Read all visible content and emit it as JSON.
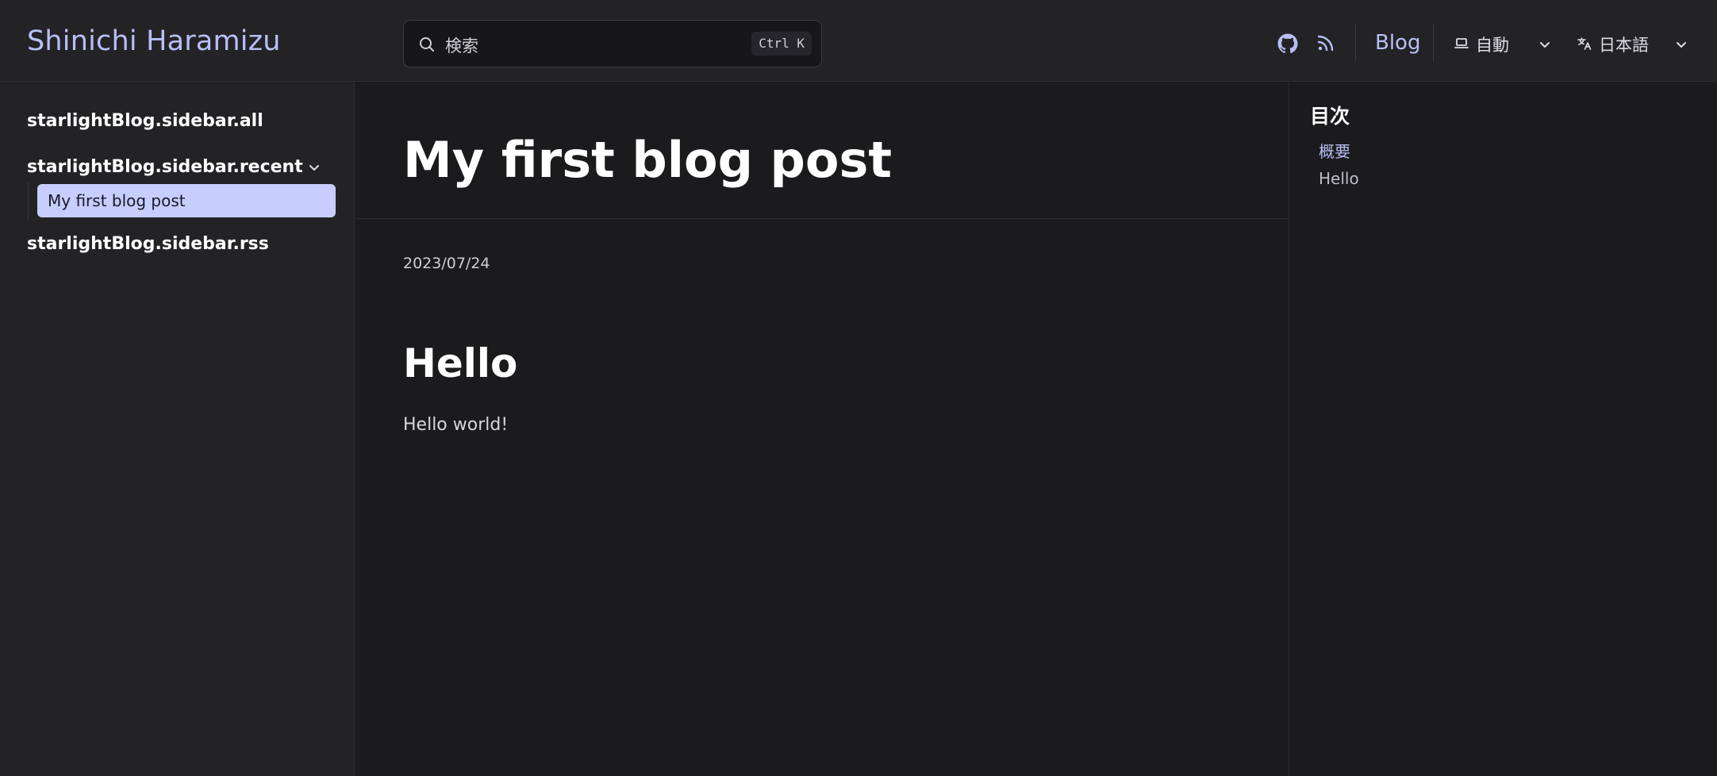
{
  "header": {
    "site_title": "Shinichi Haramizu",
    "search": {
      "placeholder": "検索",
      "shortcut": "Ctrl K"
    },
    "icons": [
      "github-icon",
      "rss-icon"
    ],
    "blog_link": "Blog",
    "theme_select": {
      "value": "自動",
      "icon": "laptop-icon"
    },
    "language_select": {
      "value": "日本語",
      "icon": "translate-icon"
    }
  },
  "sidebar": {
    "items": [
      {
        "label": "starlightBlog.sidebar.all"
      },
      {
        "label": "starlightBlog.sidebar.recent",
        "expanded": true,
        "children": [
          {
            "label": "My first blog post",
            "current": true
          }
        ]
      },
      {
        "label": "starlightBlog.sidebar.rss"
      }
    ]
  },
  "main": {
    "title": "My first blog post",
    "date": "2023/07/24",
    "heading": "Hello",
    "paragraph": "Hello world!"
  },
  "toc": {
    "title": "目次",
    "items": [
      {
        "label": "概要",
        "active": true
      },
      {
        "label": "Hello",
        "active": false
      }
    ]
  },
  "colors": {
    "accent": "#b8bff5",
    "accent_bg": "#c8cefb",
    "header_bg": "#232326",
    "content_bg": "#1b1b1d"
  }
}
